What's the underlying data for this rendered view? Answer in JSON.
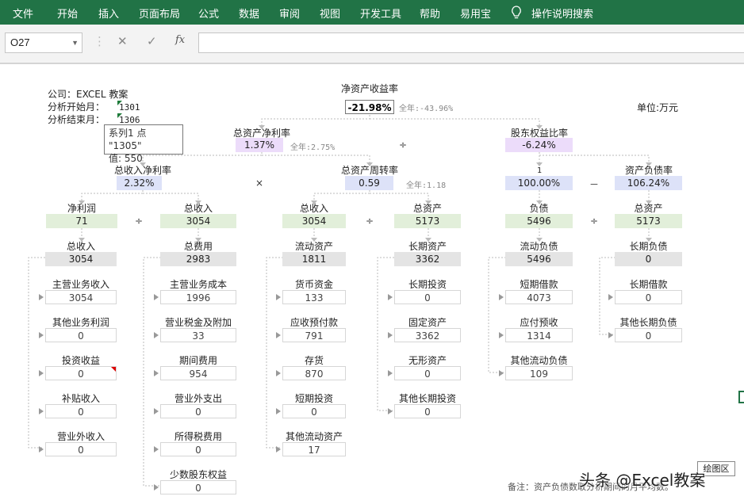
{
  "ribbon": {
    "tabs": [
      "文件",
      "开始",
      "插入",
      "页面布局",
      "公式",
      "数据",
      "审阅",
      "视图",
      "开发工具",
      "帮助",
      "易用宝"
    ],
    "search": "操作说明搜索"
  },
  "formula_bar": {
    "name_box": "O27",
    "cancel": "✕",
    "enter": "✓",
    "fx": "fx",
    "formula": ""
  },
  "header": {
    "company_label": "公司：EXCEL 教案",
    "start_label": "分析开始月：",
    "start_value": "1301",
    "end_label": "分析结束月：",
    "end_value": "1306",
    "unit": "单位:万元"
  },
  "tooltip": {
    "line1": "系列1 点 \"1305\"",
    "line2": "值: 550"
  },
  "year_prefix": "全年:",
  "roe": {
    "label": "净资产收益率",
    "value": "-21.98%",
    "year": "-43.96%"
  },
  "roa": {
    "label": "总资产净利率",
    "value": "1.37%",
    "year": "2.75%"
  },
  "equity_multiplier": {
    "label": "股东权益比率",
    "value": "-6.24%"
  },
  "net_margin": {
    "label": "总收入净利率",
    "value": "2.32%"
  },
  "asset_turnover": {
    "label": "总资产周转率",
    "value": "0.59",
    "year": "1.18"
  },
  "one": {
    "label": "1",
    "value": "100.00%"
  },
  "debt_ratio": {
    "label": "资产负债率",
    "value": "106.24%"
  },
  "l3": {
    "net_profit": {
      "label": "净利润",
      "value": "71"
    },
    "total_revenue_a": {
      "label": "总收入",
      "value": "3054"
    },
    "total_revenue_b": {
      "label": "总收入",
      "value": "3054"
    },
    "total_assets_a": {
      "label": "总资产",
      "value": "5173"
    },
    "liabilities": {
      "label": "负债",
      "value": "5496"
    },
    "total_assets_b": {
      "label": "总资产",
      "value": "5173"
    }
  },
  "ops": {
    "multiply1": "×",
    "multiply2": "×",
    "divide": "÷",
    "minus": "－"
  },
  "columns": [
    {
      "head": {
        "label": "总收入",
        "value": "3054"
      },
      "items": [
        {
          "label": "主营业务收入",
          "value": "3054"
        },
        {
          "label": "其他业务利润",
          "value": "0"
        },
        {
          "label": "投资收益",
          "value": "0"
        },
        {
          "label": "补贴收入",
          "value": "0"
        },
        {
          "label": "营业外收入",
          "value": "0"
        }
      ]
    },
    {
      "head": {
        "label": "总费用",
        "value": "2983"
      },
      "items": [
        {
          "label": "主营业务成本",
          "value": "1996"
        },
        {
          "label": "营业税金及附加",
          "value": "33"
        },
        {
          "label": "期间费用",
          "value": "954"
        },
        {
          "label": "营业外支出",
          "value": "0"
        },
        {
          "label": "所得税费用",
          "value": "0"
        },
        {
          "label": "少数股东权益",
          "value": "0"
        }
      ]
    },
    {
      "head": {
        "label": "流动资产",
        "value": "1811"
      },
      "items": [
        {
          "label": "货币资金",
          "value": "133"
        },
        {
          "label": "应收预付款",
          "value": "791"
        },
        {
          "label": "存货",
          "value": "870"
        },
        {
          "label": "短期投资",
          "value": "0"
        },
        {
          "label": "其他流动资产",
          "value": "17"
        }
      ]
    },
    {
      "head": {
        "label": "长期资产",
        "value": "3362"
      },
      "items": [
        {
          "label": "长期投资",
          "value": "0"
        },
        {
          "label": "固定资产",
          "value": "3362"
        },
        {
          "label": "无形资产",
          "value": "0"
        },
        {
          "label": "其他长期投资",
          "value": "0"
        }
      ]
    },
    {
      "head": {
        "label": "流动负债",
        "value": "5496"
      },
      "items": [
        {
          "label": "短期借款",
          "value": "4073"
        },
        {
          "label": "应付预收",
          "value": "1314"
        },
        {
          "label": "其他流动负债",
          "value": "109"
        }
      ]
    },
    {
      "head": {
        "label": "长期负债",
        "value": "0"
      },
      "items": [
        {
          "label": "长期借款",
          "value": "0"
        },
        {
          "label": "其他长期负债",
          "value": "0"
        }
      ]
    }
  ],
  "plot_button": "绘图区",
  "note": "备注：资产负债数取分析期间的月平均数。",
  "watermark": "头条 @Excel教案"
}
